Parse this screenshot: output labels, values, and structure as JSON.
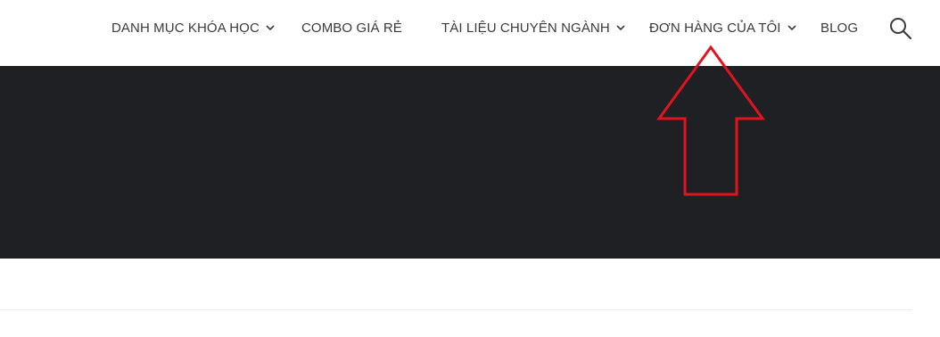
{
  "nav": {
    "items": [
      {
        "label": "DANH MỤC KHÓA HỌC",
        "has_dropdown": true
      },
      {
        "label": "COMBO GIÁ RẺ",
        "has_dropdown": false
      },
      {
        "label": "TÀI LIỆU CHUYÊN NGÀNH",
        "has_dropdown": true
      },
      {
        "label": "ĐƠN HÀNG CỦA TÔI",
        "has_dropdown": true
      },
      {
        "label": "BLOG",
        "has_dropdown": false
      }
    ],
    "search_icon": "search-icon"
  },
  "colors": {
    "nav_text": "#3a3a3a",
    "banner_bg": "#1f2024",
    "annotation_arrow": "#e0141e"
  },
  "annotation": {
    "type": "arrow-up",
    "points_to": "ĐƠN HÀNG CỦA TÔI"
  }
}
